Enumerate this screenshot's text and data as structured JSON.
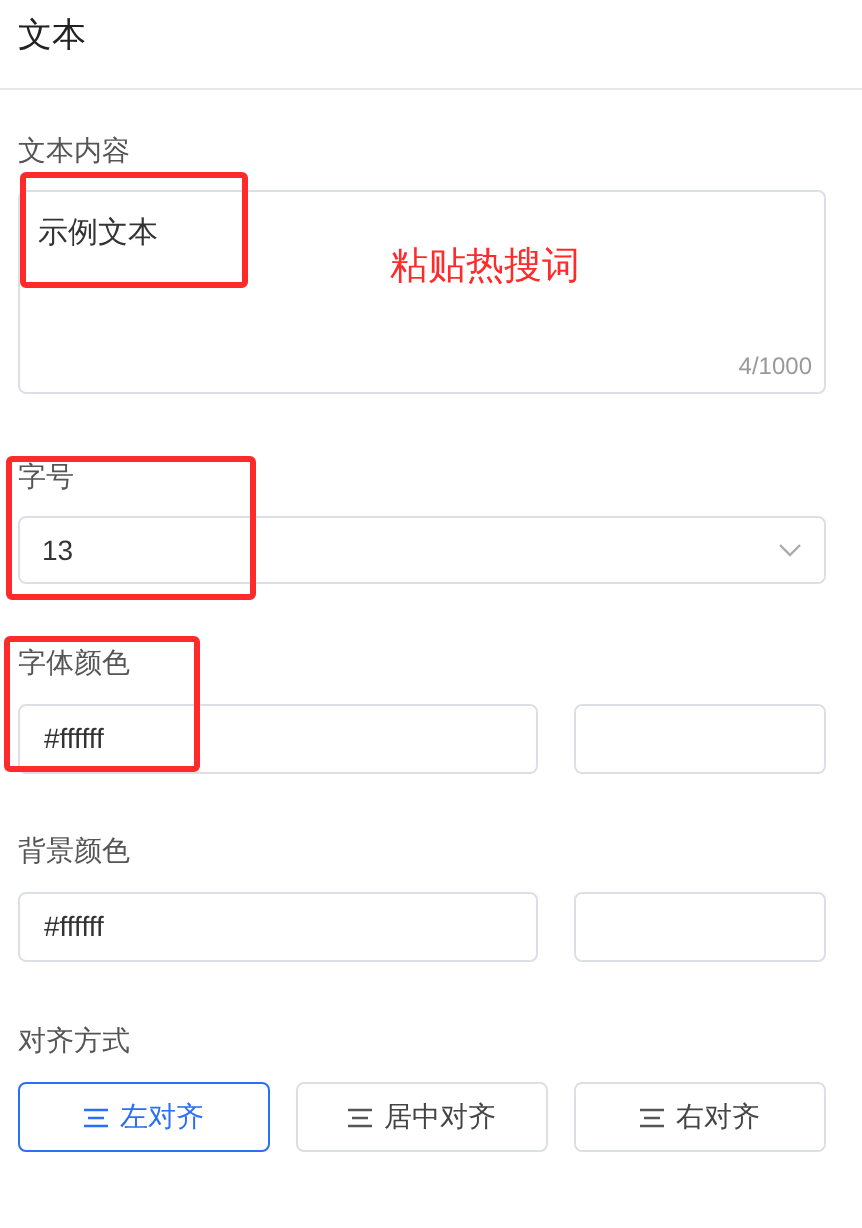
{
  "header": {
    "title": "文本"
  },
  "text_content": {
    "label": "文本内容",
    "value": "示例文本",
    "counter": "4/1000"
  },
  "font_size": {
    "label": "字号",
    "value": "13"
  },
  "font_color": {
    "label": "字体颜色",
    "value": "#ffffff"
  },
  "background_color": {
    "label": "背景颜色",
    "value": "#ffffff"
  },
  "alignment": {
    "label": "对齐方式",
    "options": [
      {
        "label": "左对齐",
        "selected": true
      },
      {
        "label": "居中对齐",
        "selected": false
      },
      {
        "label": "右对齐",
        "selected": false
      }
    ]
  },
  "annotation": {
    "note": "粘贴热搜词"
  }
}
